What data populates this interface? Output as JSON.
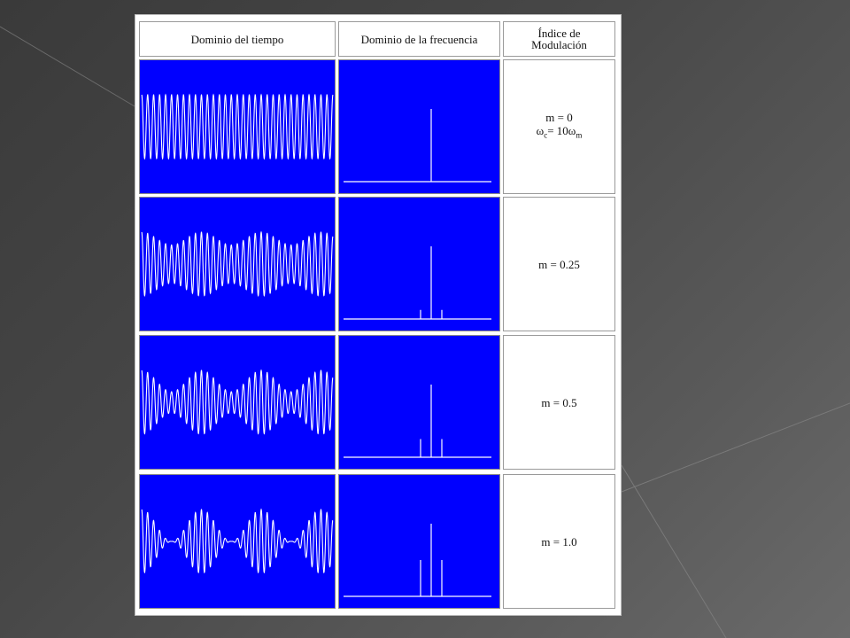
{
  "table": {
    "headers": {
      "time": "Dominio del tiempo",
      "freq": "Dominio de la frecuencia",
      "index_line1": "Índice de",
      "index_line2": "Modulación"
    },
    "rows": [
      {
        "m": 0,
        "label": "m = 0",
        "extra_pre": "ω",
        "extra_sub1": "c",
        "extra_mid": "= 10ω",
        "extra_sub2": "m"
      },
      {
        "m": 0.25,
        "label": "m = 0.25"
      },
      {
        "m": 0.5,
        "label": "m = 0.5"
      },
      {
        "m": 1.0,
        "label": "m = 1.0"
      }
    ]
  },
  "colors": {
    "panel_bg": "#0000ff",
    "trace": "#ffffff"
  },
  "signal": {
    "carrier_to_modulating_ratio": 10
  }
}
